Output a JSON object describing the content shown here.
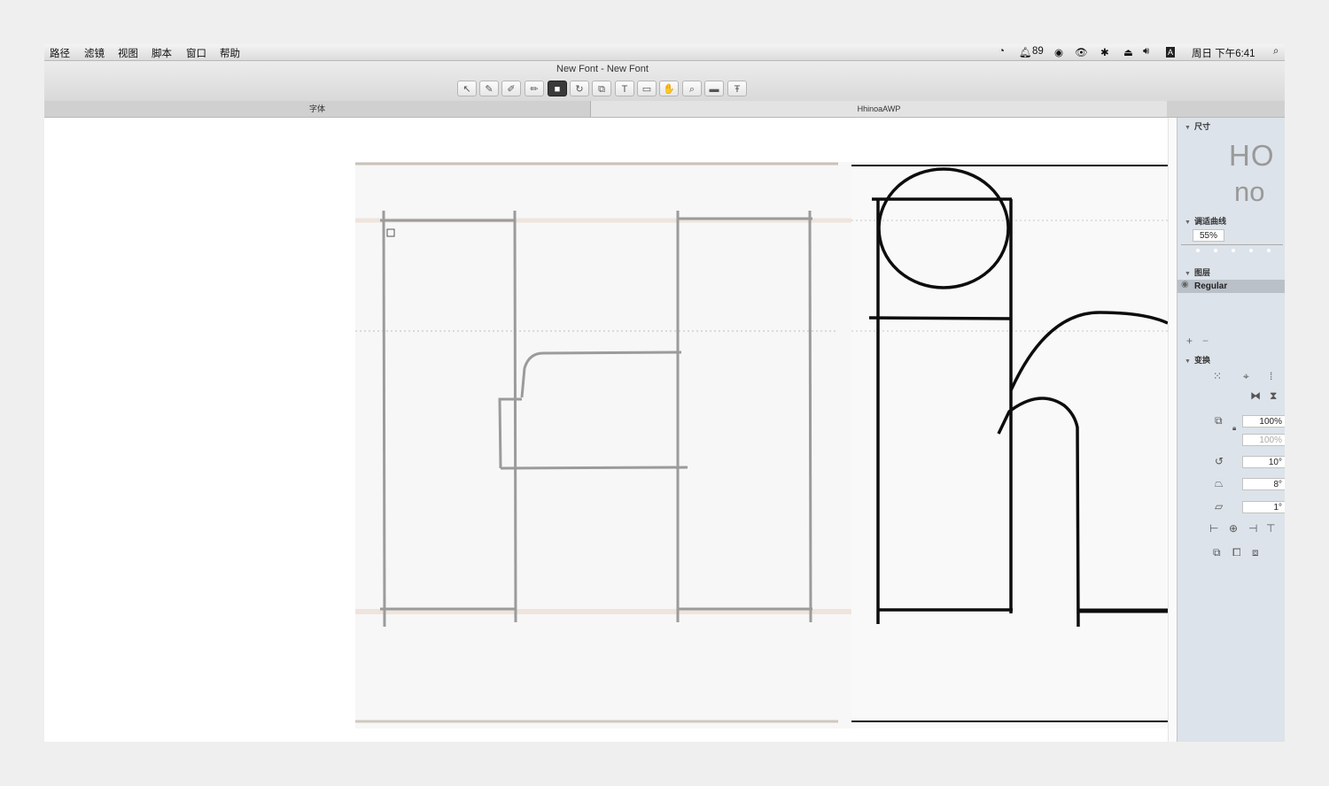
{
  "menu": [
    "路径",
    "滤镜",
    "视图",
    "脚本",
    "窗口",
    "帮助"
  ],
  "status": {
    "notifications": "89",
    "clock": "周日 下午6:41"
  },
  "window": {
    "title": "New Font - New Font"
  },
  "tabs": [
    "字体",
    "HhinoaAWP"
  ],
  "panel": {
    "dimensions_label": "尺寸",
    "preview_top": "HO",
    "preview_bottom": "no",
    "curve_label": "调适曲线",
    "curve_value": "55%",
    "layers_label": "图层",
    "layer_name": "Regular",
    "add": "+",
    "remove": "−",
    "transform_label": "变换",
    "scale_x": "100%",
    "scale_y": "100%",
    "rotate": "10°",
    "slant": "8°",
    "skew": "1°"
  }
}
